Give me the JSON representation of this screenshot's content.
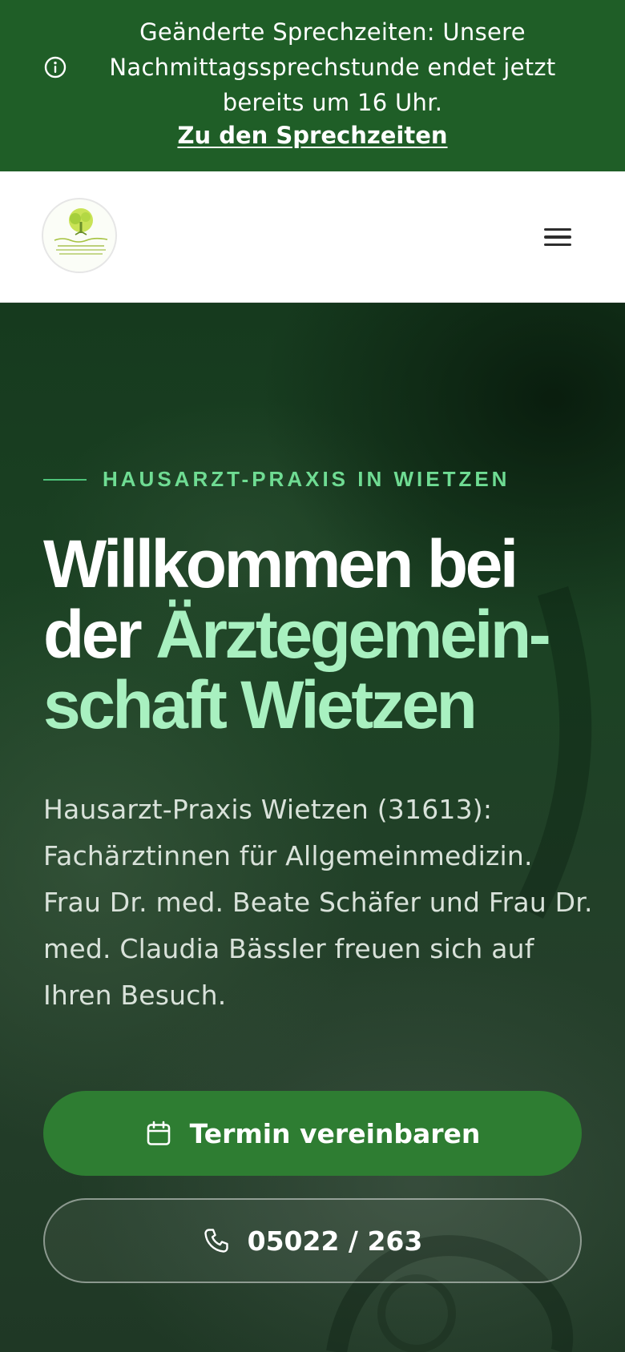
{
  "announcement": {
    "text": "Geänderte Sprechzeiten: Unsere Nachmittagssprechstunde endet jetzt bereits um 16 Uhr.",
    "link_label": "Zu den Sprechzeiten",
    "icon": "info-icon"
  },
  "header": {
    "logo_alt": "Ärztegemeinschaft Wietzen",
    "menu_icon": "hamburger-menu-icon"
  },
  "hero": {
    "eyebrow": "HAUSARZT-PRAXIS IN WIETZEN",
    "headline_white": "Willkommen bei der",
    "headline_accent": "Ärztegemein­schaft Wietzen",
    "intro": "Hausarzt-Praxis Wietzen (31613): Fachärztinnen für Allgemeinmedizin. Frau Dr. med. Beate Schäfer und Frau Dr. med. Claudia Bässler freuen sich auf Ihren Besuch.",
    "cta_primary": "Termin vereinbaren",
    "cta_primary_icon": "calendar-icon",
    "cta_phone": "05022 / 263",
    "cta_phone_icon": "phone-icon"
  },
  "colors": {
    "announcement_bg": "#1f5e27",
    "primary_button": "#2e7d32",
    "accent_text": "#a8f0c0",
    "eyebrow_text": "#6fdc93"
  }
}
